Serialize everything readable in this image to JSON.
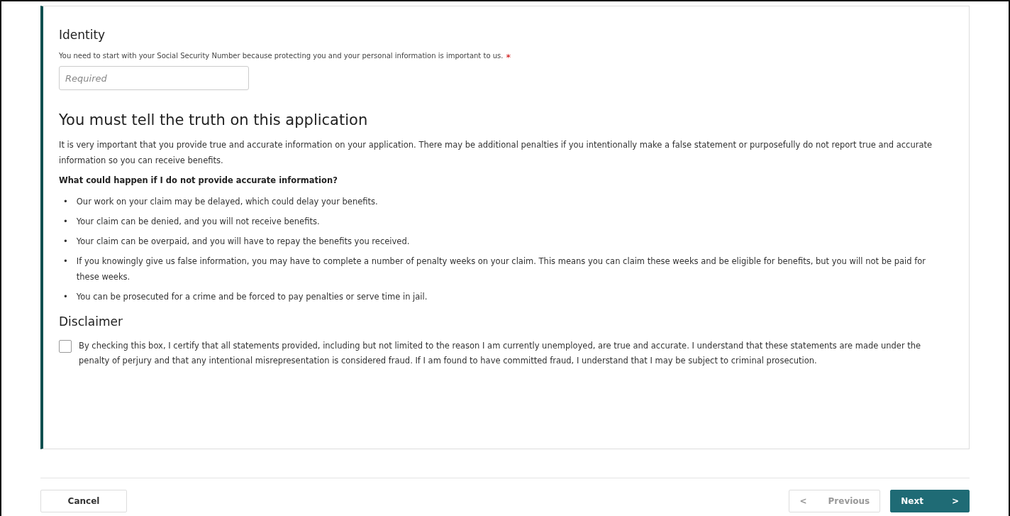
{
  "identity": {
    "title": "Identity",
    "label": "You need to start with your Social Security Number because protecting you and your personal information is important to us.",
    "required_mark": "*",
    "placeholder": "Required"
  },
  "truth": {
    "title": "You must tell the truth on this application",
    "intro": "It is very important that you provide true and accurate information on your application. There may be additional penalties if you intentionally make a false statement or purposefully do not report true and accurate information so you can receive benefits.",
    "question": "What could happen if I do not provide accurate information?",
    "bullets": [
      {
        "marker": "•",
        "text": "Our work on your claim may be delayed, which could delay your benefits."
      },
      {
        "marker": "•",
        "text": "Your claim can be denied, and you will not receive benefits."
      },
      {
        "marker": "•",
        "text": "Your claim can be overpaid, and you will have to repay the benefits you received."
      },
      {
        "marker": "•",
        "text": "If you knowingly give us false information, you may have to complete a number of penalty weeks on your claim. This means you can claim these weeks and be eligible for benefits, but you will not be paid for these weeks."
      },
      {
        "marker": "•",
        "text": "You can be prosecuted for a crime and be forced to pay penalties or serve time in jail."
      }
    ]
  },
  "disclaimer": {
    "title": "Disclaimer",
    "checked": false,
    "text": "By checking this box, I certify that all statements provided, including but not limited to the reason I am currently unemployed, are true and accurate. I understand that these statements are made under the penalty of perjury and that any intentional misrepresentation is considered fraud. If I am found to have committed fraud, I understand that I may be subject to criminal prosecution."
  },
  "footer": {
    "cancel": "Cancel",
    "previous": {
      "label": "Previous",
      "icon": "<",
      "disabled": true
    },
    "next": {
      "label": "Next",
      "icon": ">"
    }
  }
}
